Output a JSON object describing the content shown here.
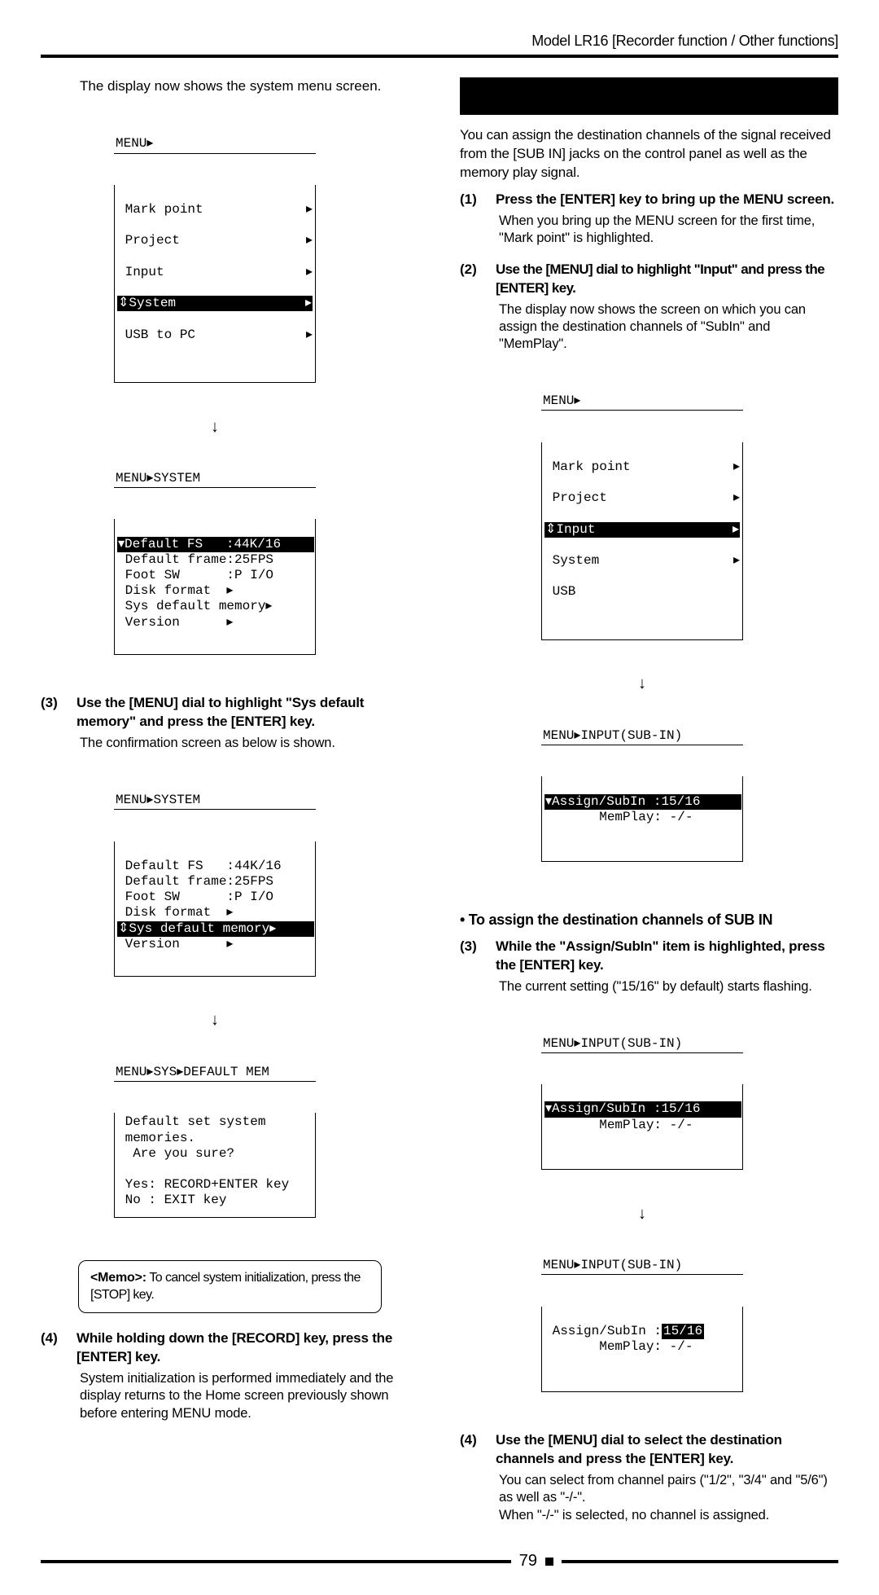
{
  "header": "Model LR16 [Recorder function / Other functions]",
  "pageNumber": "79",
  "left": {
    "intro": "The display now shows the system menu screen.",
    "lcd1_title": "MENU▸",
    "lcd1_rows": [
      {
        "label": " Mark point",
        "arrow": "▸"
      },
      {
        "label": " Project",
        "arrow": "▸"
      },
      {
        "label": " Input",
        "arrow": "▸"
      },
      {
        "label_hl": "⇕System",
        "arrow": "▸"
      },
      {
        "label": " USB to PC",
        "arrow": "▸"
      }
    ],
    "lcd2_title": "MENU▸SYSTEM",
    "lcd2_lines": [
      "▾Default FS   :44K/16",
      " Default frame:25FPS",
      " Foot SW      :P I/O",
      " Disk format  ▸",
      " Sys default memory▸",
      " Version      ▸"
    ],
    "lcd2_hl_index": 0,
    "s3_head": "Use the [MENU] dial to highlight \"Sys default memory\" and press the [ENTER] key.",
    "s3_body": "The confirmation screen as below is shown.",
    "lcd3_title": "MENU▸SYSTEM",
    "lcd3_lines": [
      " Default FS   :44K/16",
      " Default frame:25FPS",
      " Foot SW      :P I/O",
      " Disk format  ▸",
      "⇕Sys default memory▸",
      " Version      ▸"
    ],
    "lcd3_hl_index": 4,
    "lcd4_title": "MENU▸SYS▸DEFAULT MEM",
    "lcd4_body": " Default set system\n memories.\n  Are you sure?\n\n Yes: RECORD+ENTER key\n No : EXIT key",
    "memo": "<Memo>:  To cancel system initialization, press the [STOP] key.",
    "memo_bold": "<Memo>:",
    "memo_rest": "  To cancel system initialization, press the [STOP] key.",
    "s4_head": "While holding down the [RECORD] key, press the [ENTER] key.",
    "s4_body": "System initialization is performed immediately and the display returns to the Home screen previously shown before entering MENU mode."
  },
  "right": {
    "intro": "You can assign the destination channels of the signal received from the [SUB IN] jacks on the control panel as well as the memory play signal.",
    "s1_head": "Press the [ENTER] key to bring up the MENU screen.",
    "s1_body": "When you bring up the MENU screen for the first time, \"Mark point\" is highlighted.",
    "s2_head": "Use the [MENU] dial to highlight \"Input\" and press the [ENTER] key.",
    "s2_body": "The display now shows the screen on which you can assign the destination channels of \"SubIn\" and \"MemPlay\".",
    "lcd5_title": "MENU▸",
    "lcd5_rows": [
      {
        "label": " Mark point",
        "arrow": "▸"
      },
      {
        "label": " Project",
        "arrow": "▸"
      },
      {
        "label_hl": "⇕Input",
        "arrow": "▸"
      },
      {
        "label": " System",
        "arrow": "▸"
      },
      {
        "label": " USB",
        "arrow": ""
      }
    ],
    "lcd6_title": "MENU▸INPUT(SUB-IN)",
    "lcd6_line_hl": "▾Assign/SubIn :15/16",
    "lcd6_line2": "       MemPlay: -/-",
    "subhead": "• To assign the destination channels of SUB IN",
    "s3_head": "While the \"Assign/SubIn\" item is highlighted, press the [ENTER] key.",
    "s3_body": "The current setting (\"15/16\" by default) starts flashing.",
    "lcd7_title": "MENU▸INPUT(SUB-IN)",
    "lcd7_line_hl": "▾Assign/SubIn :15/16",
    "lcd7_line2": "       MemPlay: -/-",
    "lcd8_title": "MENU▸INPUT(SUB-IN)",
    "lcd8_line1_pre": " Assign/SubIn :",
    "lcd8_val": "15/16",
    "lcd8_line2": "       MemPlay: -/-",
    "s4_head": "Use the [MENU] dial to select the destination channels and press the [ENTER] key.",
    "s4_body": "You can select from channel pairs (\"1/2\", \"3/4\" and \"5/6\") as well as \"-/-\".\nWhen \"-/-\" is selected, no channel is assigned."
  }
}
